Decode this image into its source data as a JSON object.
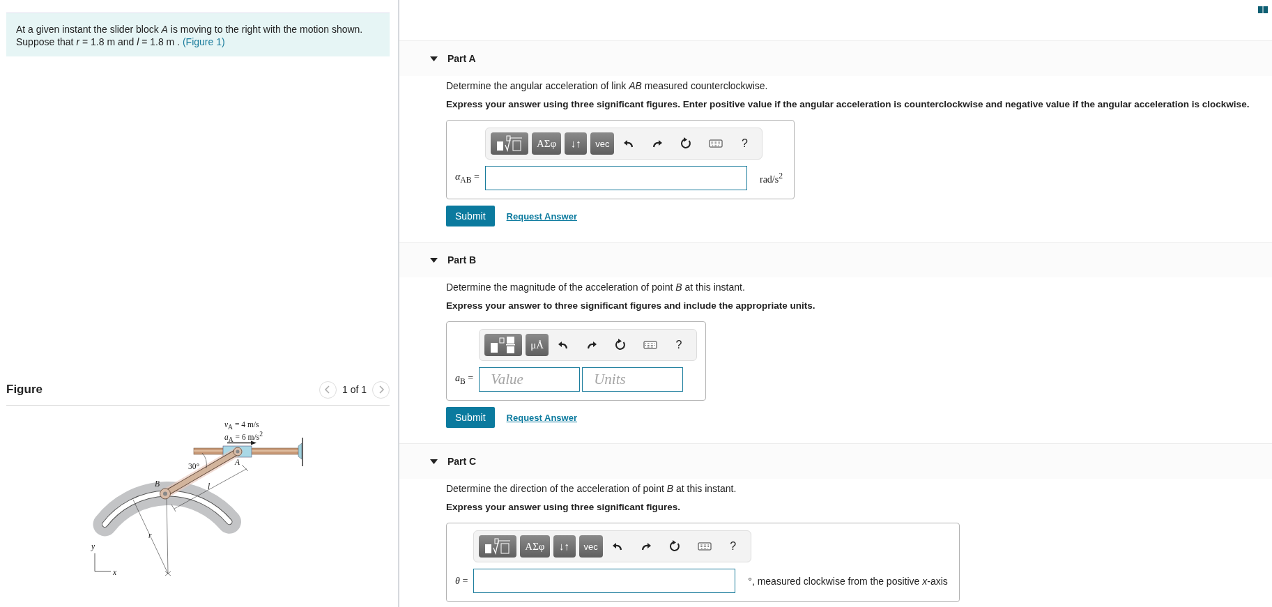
{
  "problem": {
    "text": "At a given instant the slider block *A* is moving to the right with the motion shown. Suppose that *r* = 1.8  m and *l* = 1.8  m .",
    "link": "(Figure 1)"
  },
  "figure": {
    "title": "Figure",
    "pager": "1 of 1",
    "labels": [
      "*v*$_{A}$ = 4 m/s",
      "*a*$_{A}$ = 6 m/s$^{2}$",
      "30°",
      "*A*",
      "*B*",
      "*l*",
      "*r*",
      "*y*",
      "*x*"
    ]
  },
  "parts": [
    {
      "title": "Part A",
      "expanded": true,
      "question": "Determine the angular acceleration of link *AB* measured counterclockwise.",
      "instruction": "Express your answer using three significant figures. Enter positive value if the angular acceleration is counterclockwise and negative value if the angular acceleration is clockwise.",
      "answer": {
        "kind": "expression",
        "toolbar": [
          {
            "kind": "root-template"
          },
          {
            "kind": "text-key",
            "text": "ΑΣφ"
          },
          {
            "kind": "text-key",
            "text": "↓↑"
          },
          {
            "kind": "text-key",
            "text": "vec"
          },
          {
            "kind": "undo"
          },
          {
            "kind": "redo"
          },
          {
            "kind": "reset"
          },
          {
            "kind": "keyboard"
          },
          {
            "kind": "help",
            "text": "?"
          }
        ],
        "label": "*α*$_{AB}$ =",
        "unit": "rad/s$^{2}$"
      },
      "submit": "Submit",
      "request": "Request Answer"
    },
    {
      "title": "Part B",
      "expanded": true,
      "question": "Determine the magnitude of the acceleration of point *B* at this instant.",
      "instruction": "Express your answer to three significant figures and include the appropriate units.",
      "answer": {
        "kind": "value-units",
        "toolbar": [
          {
            "kind": "fraction-template"
          },
          {
            "kind": "text-key",
            "text": "μÅ"
          },
          {
            "kind": "undo"
          },
          {
            "kind": "redo"
          },
          {
            "kind": "reset"
          },
          {
            "kind": "keyboard"
          },
          {
            "kind": "help",
            "text": "?"
          }
        ],
        "label": "*a*$_{B}$ =",
        "value_placeholder": "Value",
        "units_placeholder": "Units"
      },
      "submit": "Submit",
      "request": "Request Answer"
    },
    {
      "title": "Part C",
      "expanded": true,
      "question": "Determine the direction of the acceleration of point *B* at this instant.",
      "instruction": "Express your answer using three significant figures.",
      "answer": {
        "kind": "expression",
        "toolbar": [
          {
            "kind": "root-template"
          },
          {
            "kind": "text-key",
            "text": "ΑΣφ"
          },
          {
            "kind": "text-key",
            "text": "↓↑"
          },
          {
            "kind": "text-key",
            "text": "vec"
          },
          {
            "kind": "undo"
          },
          {
            "kind": "redo"
          },
          {
            "kind": "reset"
          },
          {
            "kind": "keyboard"
          },
          {
            "kind": "help",
            "text": "?"
          }
        ],
        "label": "*θ* =",
        "unit": "°, measured clockwise from the positive *x*-axis"
      }
    }
  ]
}
